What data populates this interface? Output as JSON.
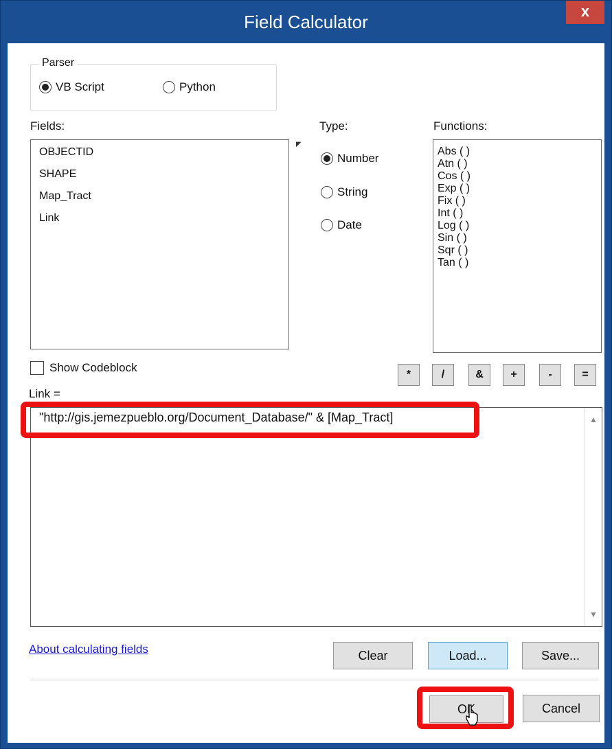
{
  "window": {
    "title": "Field Calculator",
    "close_glyph": "x"
  },
  "parser": {
    "legend": "Parser",
    "options": [
      {
        "label": "VB Script",
        "selected": true
      },
      {
        "label": "Python",
        "selected": false
      }
    ]
  },
  "fields": {
    "label": "Fields:",
    "items": [
      "OBJECTID",
      "SHAPE",
      "Map_Tract",
      "Link"
    ]
  },
  "type": {
    "label": "Type:",
    "options": [
      {
        "label": "Number",
        "selected": true
      },
      {
        "label": "String",
        "selected": false
      },
      {
        "label": "Date",
        "selected": false
      }
    ]
  },
  "functions": {
    "label": "Functions:",
    "items": [
      "Abs ( )",
      "Atn ( )",
      "Cos ( )",
      "Exp ( )",
      "Fix ( )",
      "Int ( )",
      "Log ( )",
      "Sin ( )",
      "Sqr ( )",
      "Tan ( )"
    ]
  },
  "codeblock": {
    "label": "Show Codeblock",
    "checked": false
  },
  "operators": [
    "*",
    "/",
    "&",
    "+",
    "-",
    "="
  ],
  "expression": {
    "label": "Link =",
    "value": "\"http://gis.jemezpueblo.org/Document_Database/\" & [Map_Tract]"
  },
  "links": {
    "about": "About calculating fields"
  },
  "buttons": {
    "clear": "Clear",
    "load": "Load...",
    "save": "Save...",
    "ok": "OK",
    "cancel": "Cancel"
  },
  "colors": {
    "titlebar": "#1b4f93",
    "close": "#c7463d",
    "highlight": "#ee1111",
    "link": "#1a1ad0"
  }
}
